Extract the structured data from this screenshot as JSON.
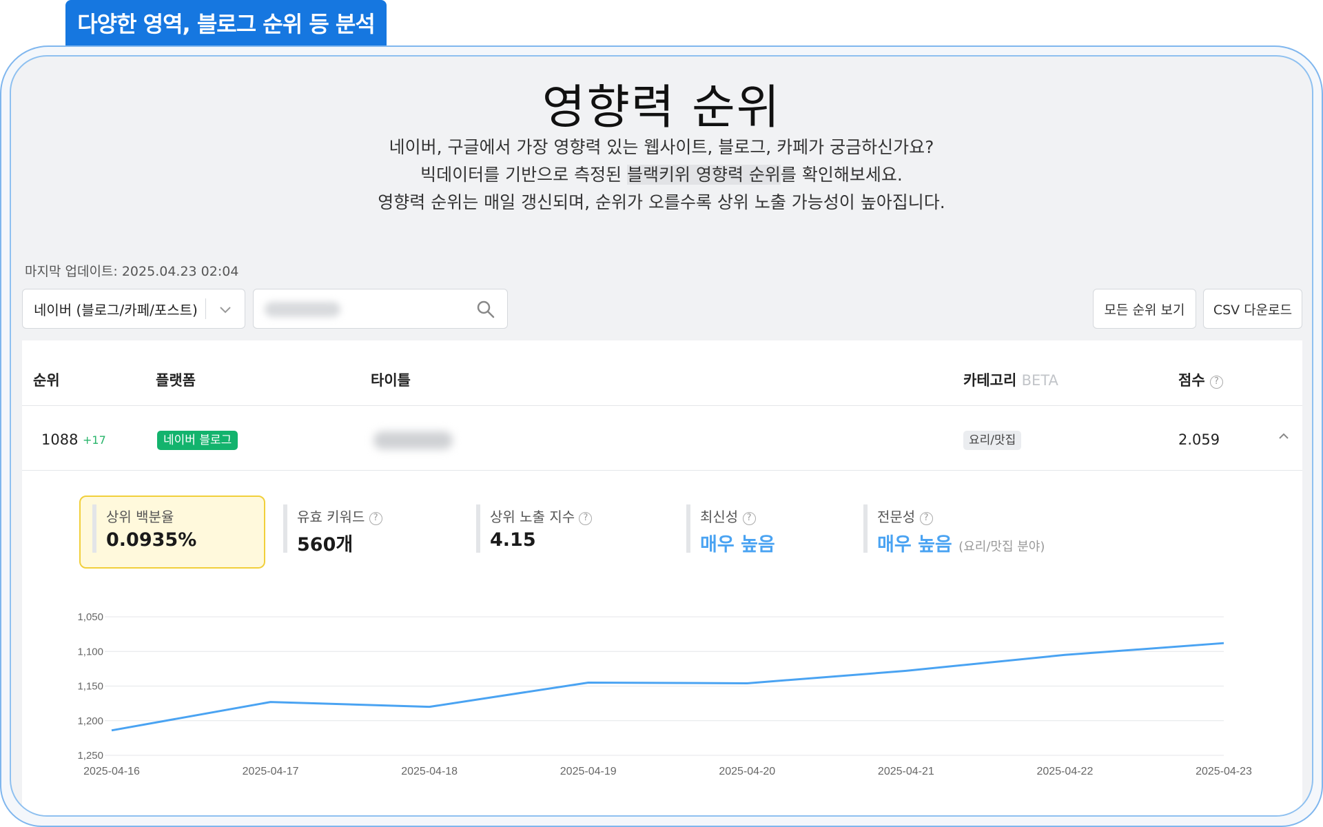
{
  "tab_label": "다양한 영역, 블로그 순위 등 분석",
  "page": {
    "title": "영향력 순위",
    "desc_line1": "네이버, 구글에서 가장 영향력 있는 웹사이트, 블로그, 카페가 궁금하신가요?",
    "desc_line2_pre": "빅데이터를 기반으로 측정된 ",
    "desc_line2_hl": "블랙키위 영향력 순위",
    "desc_line2_post": "를 확인해보세요.",
    "desc_line3": "영향력 순위는 매일 갱신되며, 순위가 오를수록 상위 노출 가능성이 높아집니다."
  },
  "last_updated": "마지막 업데이트: 2025.04.23 02:04",
  "filter": {
    "selected": "네이버 (블로그/카페/포스트)"
  },
  "buttons": {
    "all_rank": "모든 순위 보기",
    "csv": "CSV 다운로드"
  },
  "table": {
    "headers": {
      "rank": "순위",
      "platform": "플랫폼",
      "title": "타이틀",
      "category": "카테고리",
      "beta": "BETA",
      "score": "점수"
    },
    "row": {
      "rank": "1088",
      "delta": "+17",
      "platform": "네이버 블로그",
      "category": "요리/맛집",
      "score": "2.059"
    }
  },
  "metrics": [
    {
      "label": "상위 백분율",
      "value": "0.0935%"
    },
    {
      "label": "유효 키워드",
      "value": "560개"
    },
    {
      "label": "상위 노출 지수",
      "value": "4.15"
    },
    {
      "label": "최신성",
      "value": "매우 높음"
    },
    {
      "label": "전문성",
      "value": "매우 높음",
      "sub": "(요리/맛집 분야)"
    }
  ],
  "colors": {
    "accent": "#1677e0",
    "line": "#4aa3f2",
    "badge_green": "#13b36d",
    "highlight": "#fff9dc"
  },
  "chart_data": {
    "type": "line",
    "x": [
      "2025-04-16",
      "2025-04-17",
      "2025-04-18",
      "2025-04-19",
      "2025-04-20",
      "2025-04-21",
      "2025-04-22",
      "2025-04-23"
    ],
    "series": [
      {
        "values": [
          1214,
          1173,
          1180,
          1145,
          1146,
          1128,
          1105,
          1088
        ]
      }
    ],
    "y_ticks": [
      "1,050",
      "1,100",
      "1,150",
      "1,200",
      "1,250"
    ],
    "ylim": [
      1050,
      1250
    ],
    "y_inverted": true,
    "grid": true
  }
}
